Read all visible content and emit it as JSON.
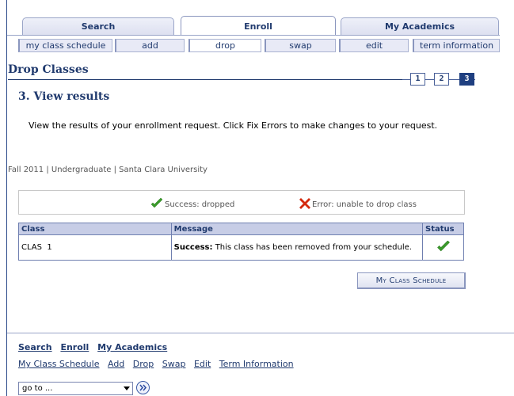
{
  "tabs": [
    {
      "label": "Search",
      "active": false
    },
    {
      "label": "Enroll",
      "active": true
    },
    {
      "label": "My Academics",
      "active": false
    }
  ],
  "subtabs": [
    {
      "label": "my class schedule",
      "active": false
    },
    {
      "label": "add",
      "active": false
    },
    {
      "label": "drop",
      "active": true
    },
    {
      "label": "swap",
      "active": false
    },
    {
      "label": "edit",
      "active": false
    },
    {
      "label": "term information",
      "active": false
    }
  ],
  "page": {
    "title": "Drop Classes",
    "steps": [
      "1",
      "2",
      "3"
    ],
    "current_step": 3,
    "step_heading": "3.  View results",
    "instructions": "View the results of your enrollment request.  Click Fix Errors to make changes to your request.",
    "term_info": "Fall 2011 | Undergraduate | Santa Clara University"
  },
  "legend": {
    "success": "Success: dropped",
    "error": "Error: unable to drop class"
  },
  "results": {
    "headers": {
      "class": "Class",
      "message": "Message",
      "status": "Status"
    },
    "rows": [
      {
        "class": "CLAS  1",
        "message_strong": "Success:",
        "message": " This class has been removed from your schedule.",
        "status": "success"
      }
    ]
  },
  "schedule_button": "My Class Schedule",
  "footer": {
    "primary_links": [
      "Search",
      "Enroll",
      "My Academics"
    ],
    "secondary_links": [
      "My Class Schedule",
      "Add",
      "Drop",
      "Swap",
      "Edit",
      "Term Information"
    ],
    "goto_value": "go to ..."
  },
  "colors": {
    "brand_blue": "#203a6e",
    "success_green": "#3a9a2a",
    "error_red": "#d42a0e"
  }
}
